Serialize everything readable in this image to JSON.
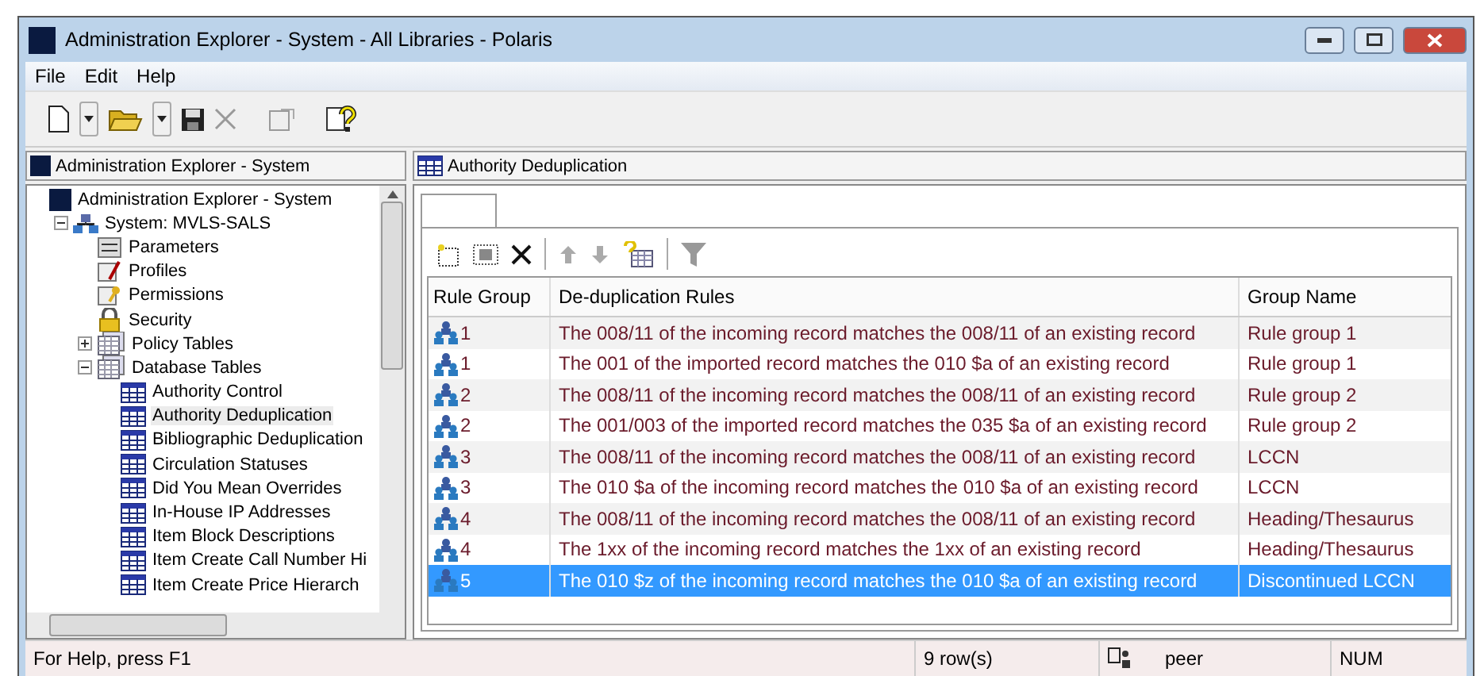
{
  "window": {
    "title": "Administration Explorer - System - All Libraries - Polaris"
  },
  "menu": [
    "File",
    "Edit",
    "Help"
  ],
  "left_pane": {
    "header": "Administration Explorer - System",
    "tree": [
      {
        "label": "Administration Explorer - System",
        "kind": "logo",
        "selected": false,
        "children": [
          {
            "label": "System: MVLS-SALS",
            "kind": "network",
            "expanded": true,
            "selected": false,
            "children": [
              {
                "label": "Parameters",
                "kind": "params",
                "selected": false
              },
              {
                "label": "Profiles",
                "kind": "profile",
                "selected": false
              },
              {
                "label": "Permissions",
                "kind": "perm",
                "selected": false
              },
              {
                "label": "Security",
                "kind": "lock",
                "selected": false
              },
              {
                "label": "Policy Tables",
                "kind": "tables",
                "expanded": false,
                "selected": false
              },
              {
                "label": "Database Tables",
                "kind": "tables",
                "expanded": true,
                "selected": false,
                "children": [
                  {
                    "label": "Authority Control",
                    "kind": "table",
                    "selected": false
                  },
                  {
                    "label": "Authority Deduplication",
                    "kind": "table",
                    "selected": true
                  },
                  {
                    "label": "Bibliographic Deduplication",
                    "kind": "table",
                    "selected": false
                  },
                  {
                    "label": "Circulation Statuses",
                    "kind": "table",
                    "selected": false
                  },
                  {
                    "label": "Did You Mean Overrides",
                    "kind": "table",
                    "selected": false
                  },
                  {
                    "label": "In-House IP Addresses",
                    "kind": "table",
                    "selected": false
                  },
                  {
                    "label": "Item Block Descriptions",
                    "kind": "table",
                    "selected": false
                  },
                  {
                    "label": "Item Create Call Number Hi",
                    "kind": "table",
                    "selected": false
                  },
                  {
                    "label": "Item Create Price Hierarch",
                    "kind": "table",
                    "selected": false
                  }
                ]
              }
            ]
          }
        ]
      }
    ]
  },
  "right_pane": {
    "header": "Authority Deduplication",
    "table": {
      "columns": [
        "Rule Group",
        "De-duplication Rules",
        "Group Name"
      ],
      "rows": [
        {
          "group": "1",
          "rule": "The 008/11 of the incoming record matches the 008/11 of an existing record",
          "name": "Rule group 1",
          "selected": false
        },
        {
          "group": "1",
          "rule": "The 001 of the imported record matches the 010 $a of an existing record",
          "name": "Rule group 1",
          "selected": false
        },
        {
          "group": "2",
          "rule": "The 008/11 of the incoming record matches the 008/11 of an existing record",
          "name": "Rule group 2",
          "selected": false
        },
        {
          "group": "2",
          "rule": "The 001/003 of the imported record matches the 035 $a of an existing record",
          "name": "Rule group 2",
          "selected": false
        },
        {
          "group": "3",
          "rule": "The 008/11 of the incoming record matches the 008/11 of an existing record",
          "name": "LCCN",
          "selected": false
        },
        {
          "group": "3",
          "rule": "The 010 $a of the incoming record matches the 010 $a of an existing record",
          "name": "LCCN",
          "selected": false
        },
        {
          "group": "4",
          "rule": "The 008/11 of the incoming record matches the 008/11 of an existing record",
          "name": "Heading/Thesaurus",
          "selected": false
        },
        {
          "group": "4",
          "rule": "The 1xx of the incoming record matches the 1xx of an existing record",
          "name": "Heading/Thesaurus",
          "selected": false
        },
        {
          "group": "5",
          "rule": "The 010 $z of the incoming record matches the 010 $a of an existing record",
          "name": "Discontinued LCCN",
          "selected": true
        }
      ]
    }
  },
  "status_bar": {
    "help": "For Help, press F1",
    "rows": "9 row(s)",
    "user": "peer",
    "num": "NUM"
  }
}
